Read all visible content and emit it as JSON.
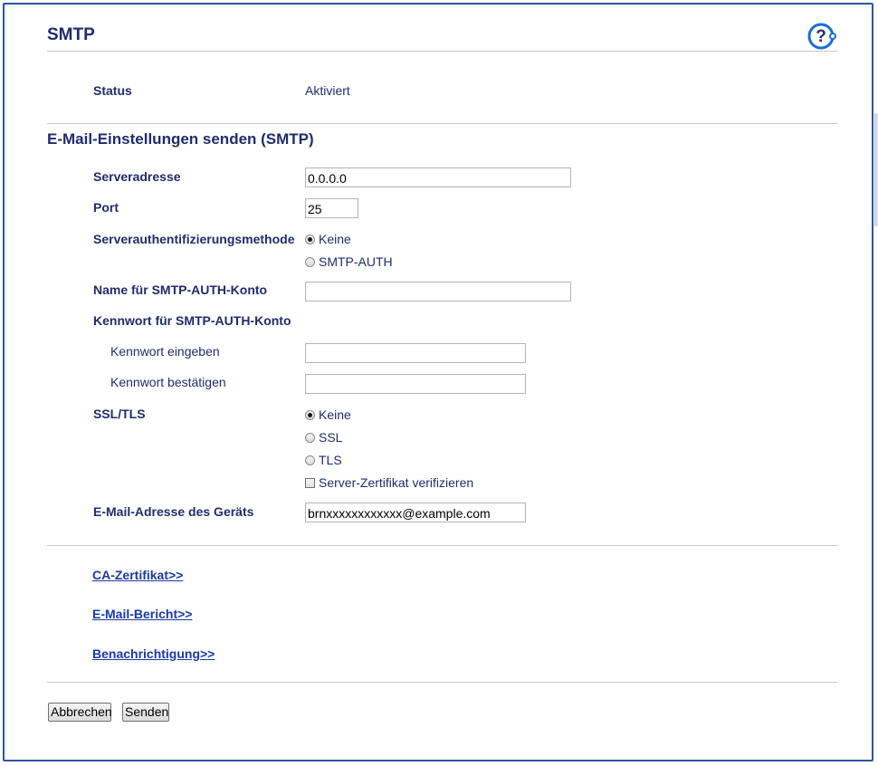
{
  "page": {
    "title": "SMTP",
    "help_icon": "help-question-icon"
  },
  "status": {
    "label": "Status",
    "value": "Aktiviert"
  },
  "section": {
    "title": "E-Mail-Einstellungen senden (SMTP)"
  },
  "server_address": {
    "label": "Serveradresse",
    "value": "0.0.0.0"
  },
  "port": {
    "label": "Port",
    "value": "25"
  },
  "auth_method": {
    "label": "Serverauthentifizierungsmethode",
    "options": [
      "Keine",
      "SMTP-AUTH"
    ],
    "selected": "Keine"
  },
  "auth_account": {
    "label": "Name für SMTP-AUTH-Konto",
    "value": ""
  },
  "password": {
    "label": "Kennwort für SMTP-AUTH-Konto",
    "enter_label": "Kennwort eingeben",
    "confirm_label": "Kennwort bestätigen",
    "enter_value": "",
    "confirm_value": ""
  },
  "ssl_tls": {
    "label": "SSL/TLS",
    "options": [
      "Keine",
      "SSL",
      "TLS"
    ],
    "selected": "Keine",
    "verify_label": "Server-Zertifikat verifizieren",
    "verify_checked": false
  },
  "device_email": {
    "label": "E-Mail-Adresse des Geräts",
    "value": "brnxxxxxxxxxxxx@example.com"
  },
  "links": {
    "ca_cert": "CA-Zertifikat>>",
    "email_report": "E-Mail-Bericht>>",
    "notification": "Benachrichtigung>>"
  },
  "buttons": {
    "cancel": "Abbrechen",
    "submit": "Senden"
  },
  "colors": {
    "text": "#1f2d6b",
    "link": "#1a3aa0",
    "frame": "#2d55a0",
    "help_icon": "#1a6fd0"
  }
}
